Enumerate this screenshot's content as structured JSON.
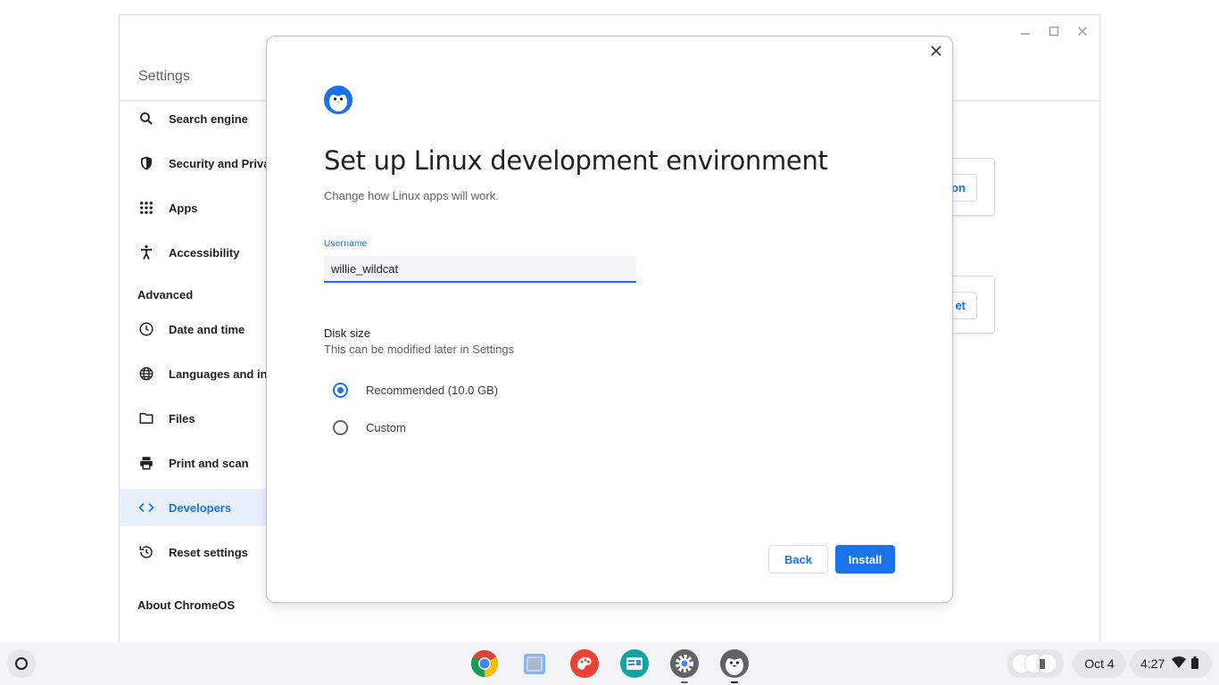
{
  "settings": {
    "title": "Settings",
    "nav": {
      "search_engine": "Search engine",
      "security": "Security and Privacy",
      "apps": "Apps",
      "accessibility": "Accessibility",
      "advanced_header": "Advanced",
      "date_time": "Date and time",
      "languages": "Languages and inputs",
      "files": "Files",
      "print_scan": "Print and scan",
      "developers": "Developers",
      "reset": "Reset settings",
      "about": "About ChromeOS"
    },
    "bg_button_1": "on",
    "bg_button_2": "et"
  },
  "dialog": {
    "title": "Set up Linux development environment",
    "subtitle": "Change how Linux apps will work.",
    "username_label": "Username",
    "username_value": "willie_wildcat",
    "disk_size_label": "Disk size",
    "disk_size_sub": "This can be modified later in Settings",
    "option_recommended": "Recommended (10.0 GB)",
    "option_custom": "Custom",
    "selected_option": "Recommended (10.0 GB)",
    "back_label": "Back",
    "install_label": "Install"
  },
  "shelf": {
    "apps": [
      "chrome-icon",
      "files-icon",
      "canvas-icon",
      "news-icon",
      "settings-icon",
      "linux-terminal-icon"
    ],
    "date": "Oct 4",
    "time": "4:27"
  },
  "colors": {
    "accent": "#1a73e8",
    "nav_active_bg": "#e8f0fe"
  }
}
